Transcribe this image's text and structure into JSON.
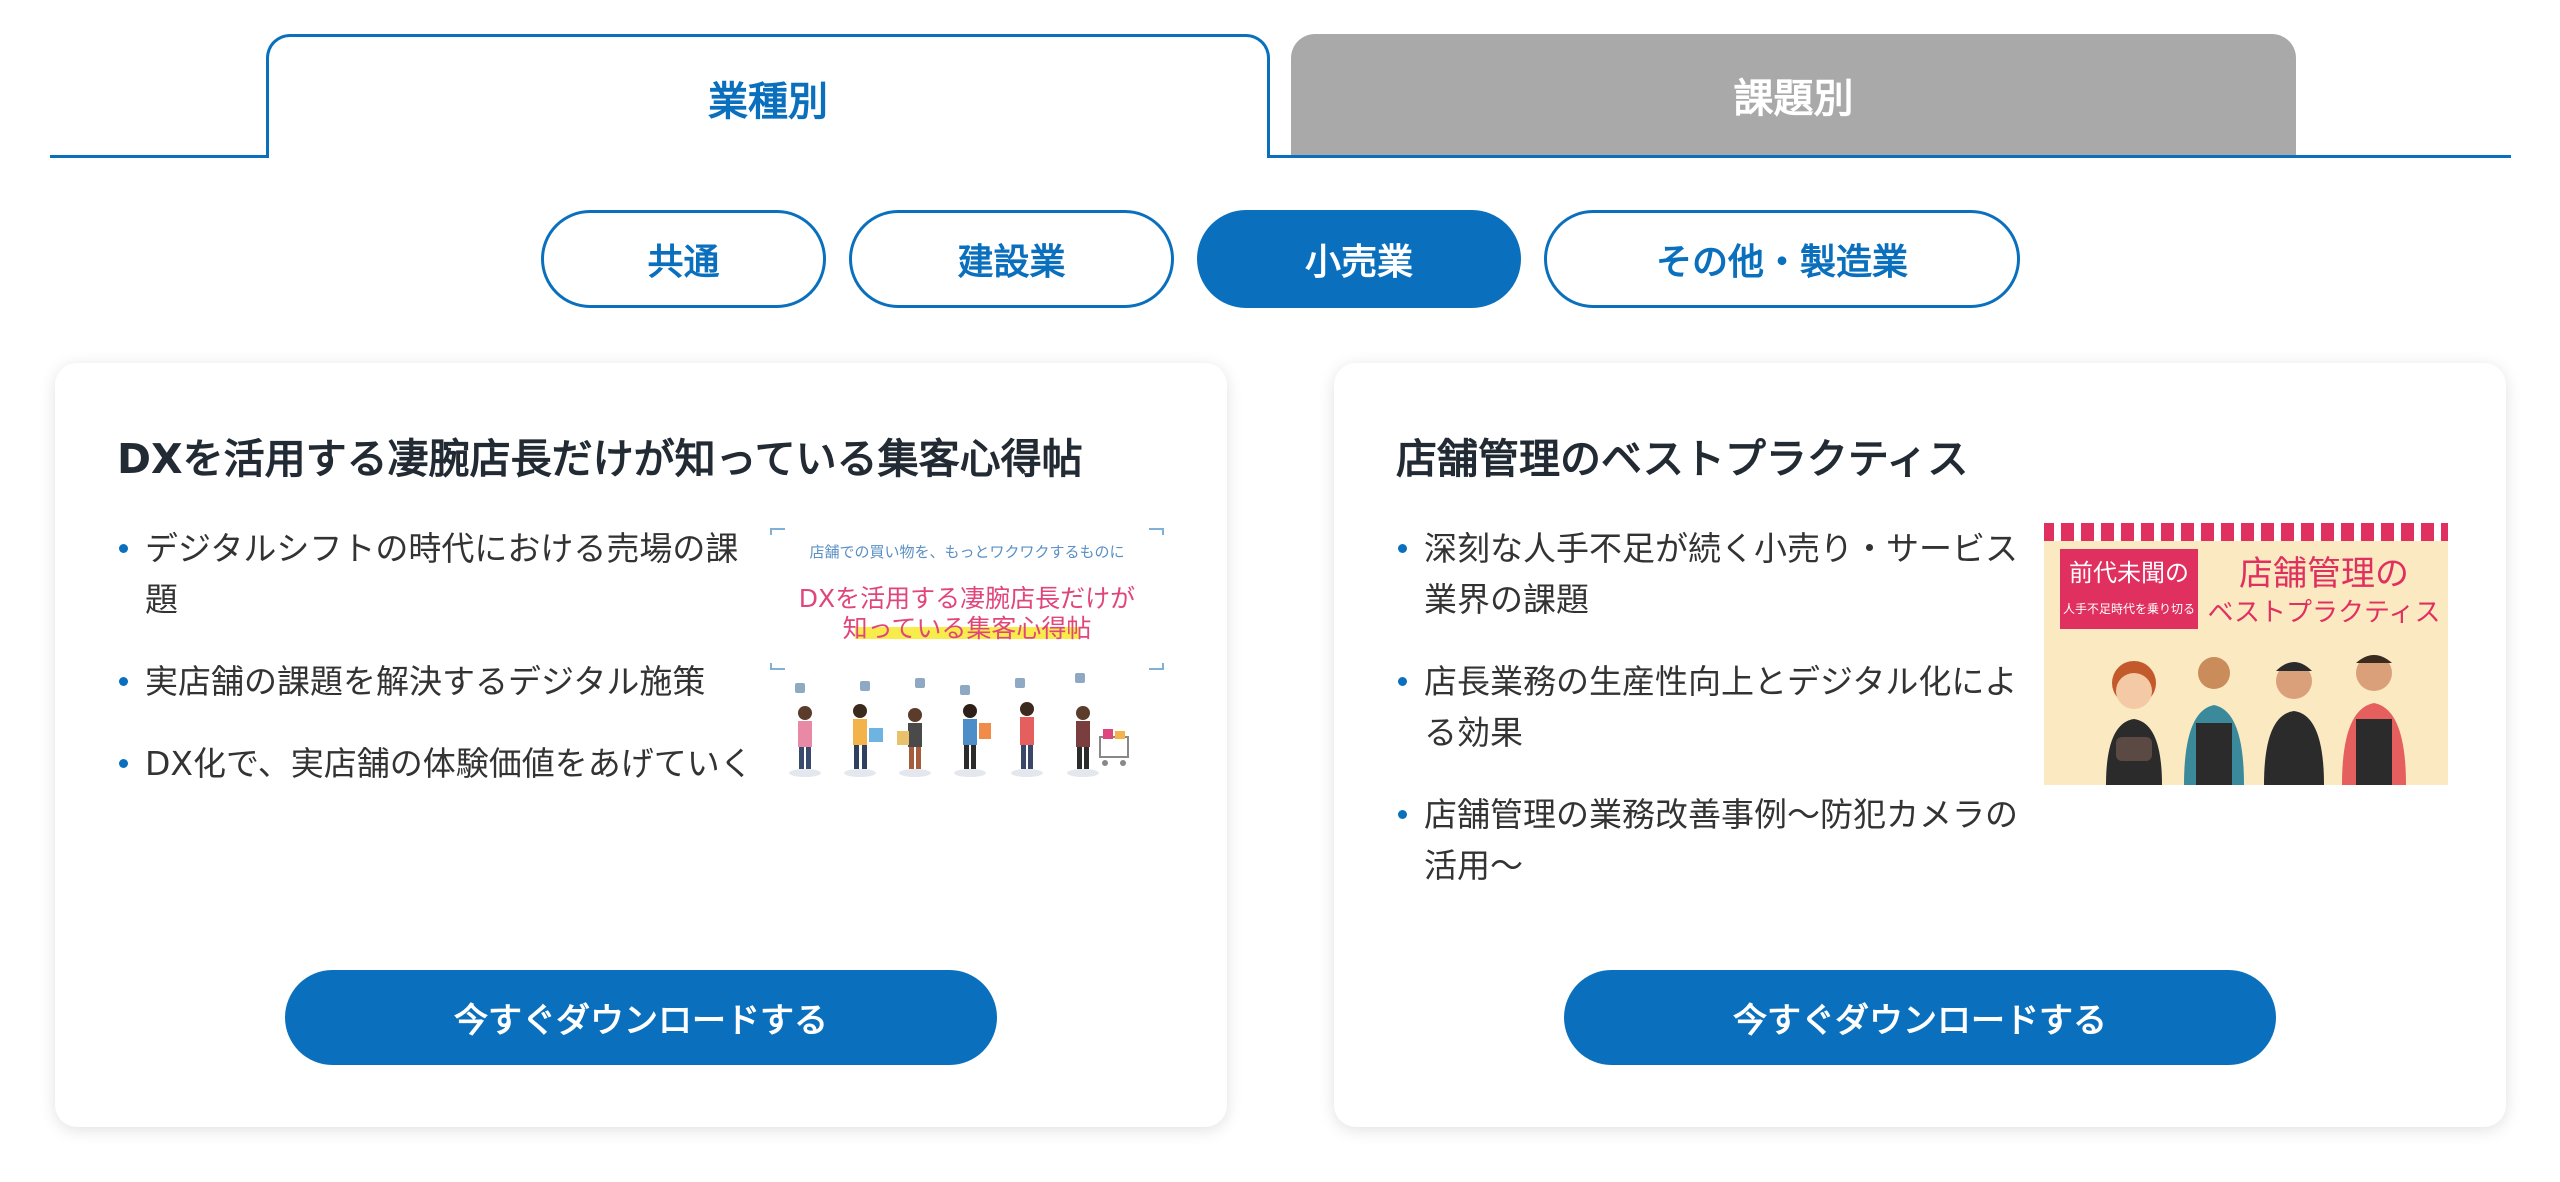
{
  "main_tabs": [
    {
      "label": "業種別",
      "active": true
    },
    {
      "label": "課題別",
      "active": false
    }
  ],
  "sub_tabs": [
    {
      "label": "共通",
      "selected": false
    },
    {
      "label": "建設業",
      "selected": false
    },
    {
      "label": "小売業",
      "selected": true
    },
    {
      "label": "その他・製造業",
      "selected": false
    }
  ],
  "cards": [
    {
      "title": "DXを活用する凄腕店長だけが知っている集客心得帖",
      "bullets": [
        "デジタルシフトの時代における売場の課題",
        "実店舗の課題を解決するデジタル施策",
        "DX化で、実店舗の体験価値をあげていく"
      ],
      "button": "今すぐダウンロードする",
      "thumbnail": {
        "line1": "店舗での買い物を、もっとワクワクするものに",
        "line2": "DXを活用する凄腕店長だけが",
        "line3": "知っている集客心得帖"
      }
    },
    {
      "title": "店舗管理のベストプラクティス",
      "bullets": [
        "深刻な人手不足が続く小売り・サービス業界の課題",
        "店長業務の生産性向上とデジタル化による効果",
        "店舗管理の業務改善事例〜防犯カメラの活用〜"
      ],
      "button": "今すぐダウンロードする",
      "thumbnail": {
        "badge_top": "前代未聞の",
        "badge_bottom": "人手不足時代を乗り切る",
        "title_line1": "店舗管理の",
        "title_line2": "ベストプラクティス"
      }
    }
  ],
  "colors": {
    "accent": "#0a70be",
    "inactive_tab": "#a9a9a9"
  }
}
